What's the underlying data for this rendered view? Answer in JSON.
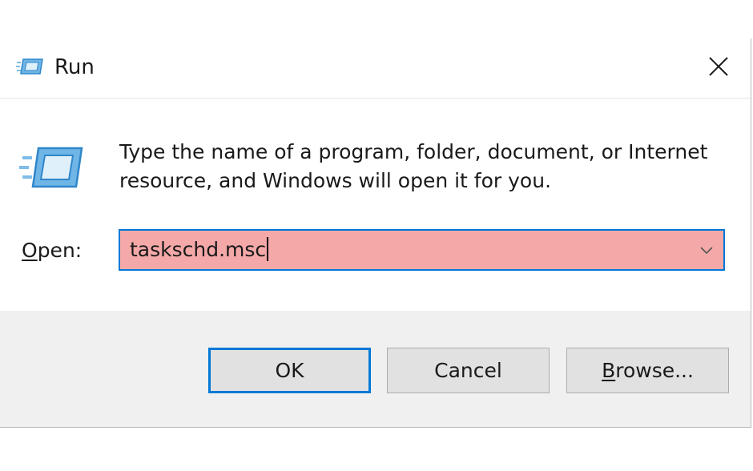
{
  "window": {
    "title": "Run",
    "title_icon": "run-icon",
    "close_icon": "close-icon"
  },
  "content": {
    "icon": "run-icon",
    "description": "Type the name of a program, folder, document, or Internet resource, and Windows will open it for you.",
    "open_label_mnemonic": "O",
    "open_label_rest": "pen:",
    "open_value": "taskschd.msc",
    "dropdown_icon": "chevron-down-icon"
  },
  "buttons": {
    "ok_label": "OK",
    "cancel_label": "Cancel",
    "browse_mnemonic": "B",
    "browse_rest": "rowse..."
  },
  "colors": {
    "accent": "#0078d7",
    "input_highlight": "#f4a9a8",
    "dialog_background": "#f0f0f0",
    "button_face": "#e1e1e1"
  }
}
